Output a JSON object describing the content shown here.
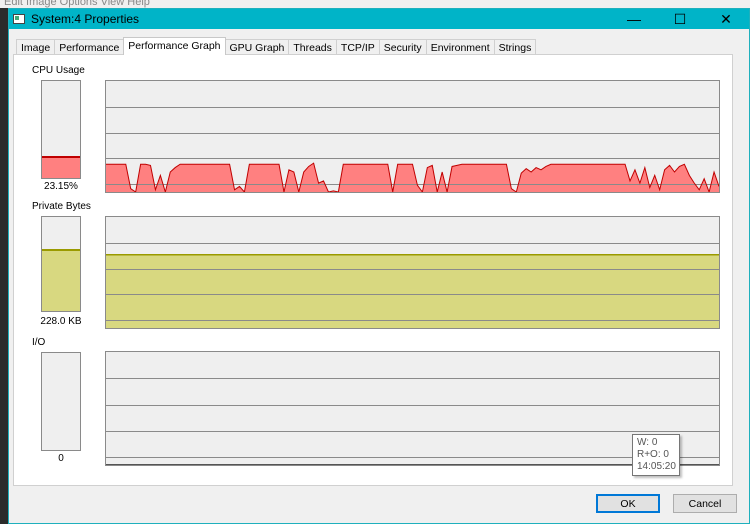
{
  "background_menu": "Edit   Image   Options   View   Help",
  "window": {
    "title": "System:4 Properties",
    "minimize": "—",
    "maximize": "☐",
    "close": "✕"
  },
  "tabs": [
    {
      "label": "Image"
    },
    {
      "label": "Performance"
    },
    {
      "label": "Performance Graph",
      "active": true
    },
    {
      "label": "GPU Graph"
    },
    {
      "label": "Threads"
    },
    {
      "label": "TCP/IP"
    },
    {
      "label": "Security"
    },
    {
      "label": "Environment"
    },
    {
      "label": "Strings"
    }
  ],
  "cpu": {
    "label": "CPU Usage",
    "value": "23.15%",
    "level_percent": 23.15,
    "color": "#ff8080",
    "line_color": "#c00000"
  },
  "private_bytes": {
    "label": "Private Bytes",
    "value": "228.0 KB",
    "level_percent": 66,
    "color": "#d8d880",
    "line_color": "#9a9a00"
  },
  "io": {
    "label": "I/O",
    "value": "0",
    "level_percent": 0
  },
  "tooltip": {
    "w": "W: 0",
    "ro": "R+O: 0",
    "time": "14:05:20"
  },
  "buttons": {
    "ok": "OK",
    "cancel": "Cancel"
  },
  "chart_data": [
    {
      "type": "area",
      "name_shown": "CPU Usage",
      "ylim": [
        0,
        100
      ],
      "grid": true,
      "values": [
        25,
        25,
        25,
        25,
        25,
        3,
        0,
        25,
        25,
        24,
        2,
        15,
        0,
        18,
        22,
        25,
        25,
        25,
        25,
        25,
        25,
        25,
        25,
        25,
        25,
        25,
        2,
        5,
        0,
        25,
        25,
        25,
        25,
        25,
        25,
        25,
        0,
        20,
        18,
        0,
        18,
        23,
        26,
        8,
        10,
        0,
        1,
        0,
        25,
        25,
        25,
        25,
        25,
        25,
        25,
        25,
        25,
        25,
        0,
        25,
        25,
        25,
        25,
        6,
        0,
        22,
        24,
        0,
        18,
        0,
        23,
        24,
        25,
        25,
        25,
        25,
        25,
        25,
        25,
        25,
        25,
        25,
        3,
        0,
        17,
        21,
        18,
        22,
        20,
        23,
        25,
        25,
        25,
        25,
        25,
        25,
        25,
        25,
        25,
        25,
        25,
        25,
        25,
        25,
        25,
        25,
        10,
        20,
        8,
        22,
        4,
        15,
        2,
        20,
        24,
        18,
        23,
        25,
        15,
        8,
        2,
        12,
        0,
        18,
        5
      ]
    },
    {
      "type": "area",
      "name_shown": "Private Bytes",
      "ylim": [
        0,
        100
      ],
      "grid": true,
      "values_percent": [
        66,
        66
      ]
    },
    {
      "type": "area",
      "name_shown": "I/O",
      "grid": true,
      "values": [
        0,
        0
      ]
    }
  ]
}
